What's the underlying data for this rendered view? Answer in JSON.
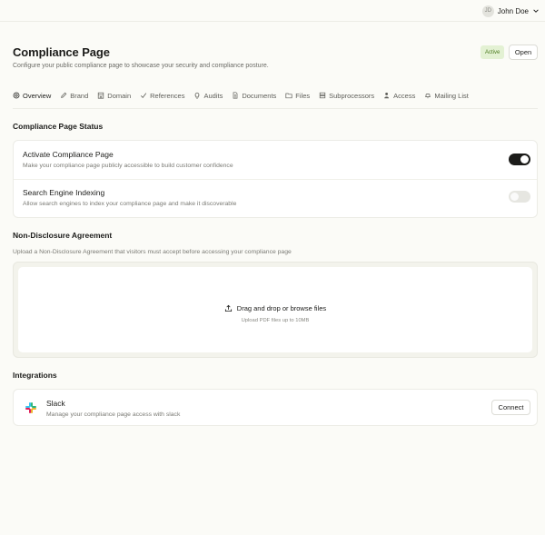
{
  "user": {
    "initials": "JD",
    "name": "John Doe"
  },
  "header": {
    "title": "Compliance Page",
    "subtitle": "Configure your public compliance page to showcase your security and compliance posture.",
    "status": "Active",
    "open_label": "Open"
  },
  "tabs": [
    {
      "label": "Overview",
      "icon": "eye-icon",
      "active": true
    },
    {
      "label": "Brand",
      "icon": "pen-icon"
    },
    {
      "label": "Domain",
      "icon": "building-icon"
    },
    {
      "label": "References",
      "icon": "check-icon"
    },
    {
      "label": "Audits",
      "icon": "lightbulb-icon"
    },
    {
      "label": "Documents",
      "icon": "document-icon"
    },
    {
      "label": "Files",
      "icon": "folder-icon"
    },
    {
      "label": "Subprocessors",
      "icon": "server-icon"
    },
    {
      "label": "Access",
      "icon": "user-icon"
    },
    {
      "label": "Mailing List",
      "icon": "bell-icon"
    }
  ],
  "status_section": {
    "title": "Compliance Page Status",
    "activate": {
      "title": "Activate Compliance Page",
      "description": "Make your compliance page publicly accessible to build customer confidence",
      "enabled": true
    },
    "indexing": {
      "title": "Search Engine Indexing",
      "description": "Allow search engines to index your compliance page and make it discoverable",
      "enabled": false
    }
  },
  "nda_section": {
    "title": "Non-Disclosure Agreement",
    "description": "Upload a Non-Disclosure Agreement that visitors must accept before accessing your compliance page",
    "drop_label": "Drag and drop or browse files",
    "drop_hint": "Upload PDF files up to 10MB"
  },
  "integrations": {
    "title": "Integrations",
    "slack": {
      "name": "Slack",
      "description": "Manage your compliance page access with slack",
      "connect_label": "Connect"
    }
  },
  "colors": {
    "accent": "#1c1c1a",
    "badge_bg": "#e3f1d3",
    "badge_text": "#4b7a1f",
    "background": "#fbfbf7"
  }
}
